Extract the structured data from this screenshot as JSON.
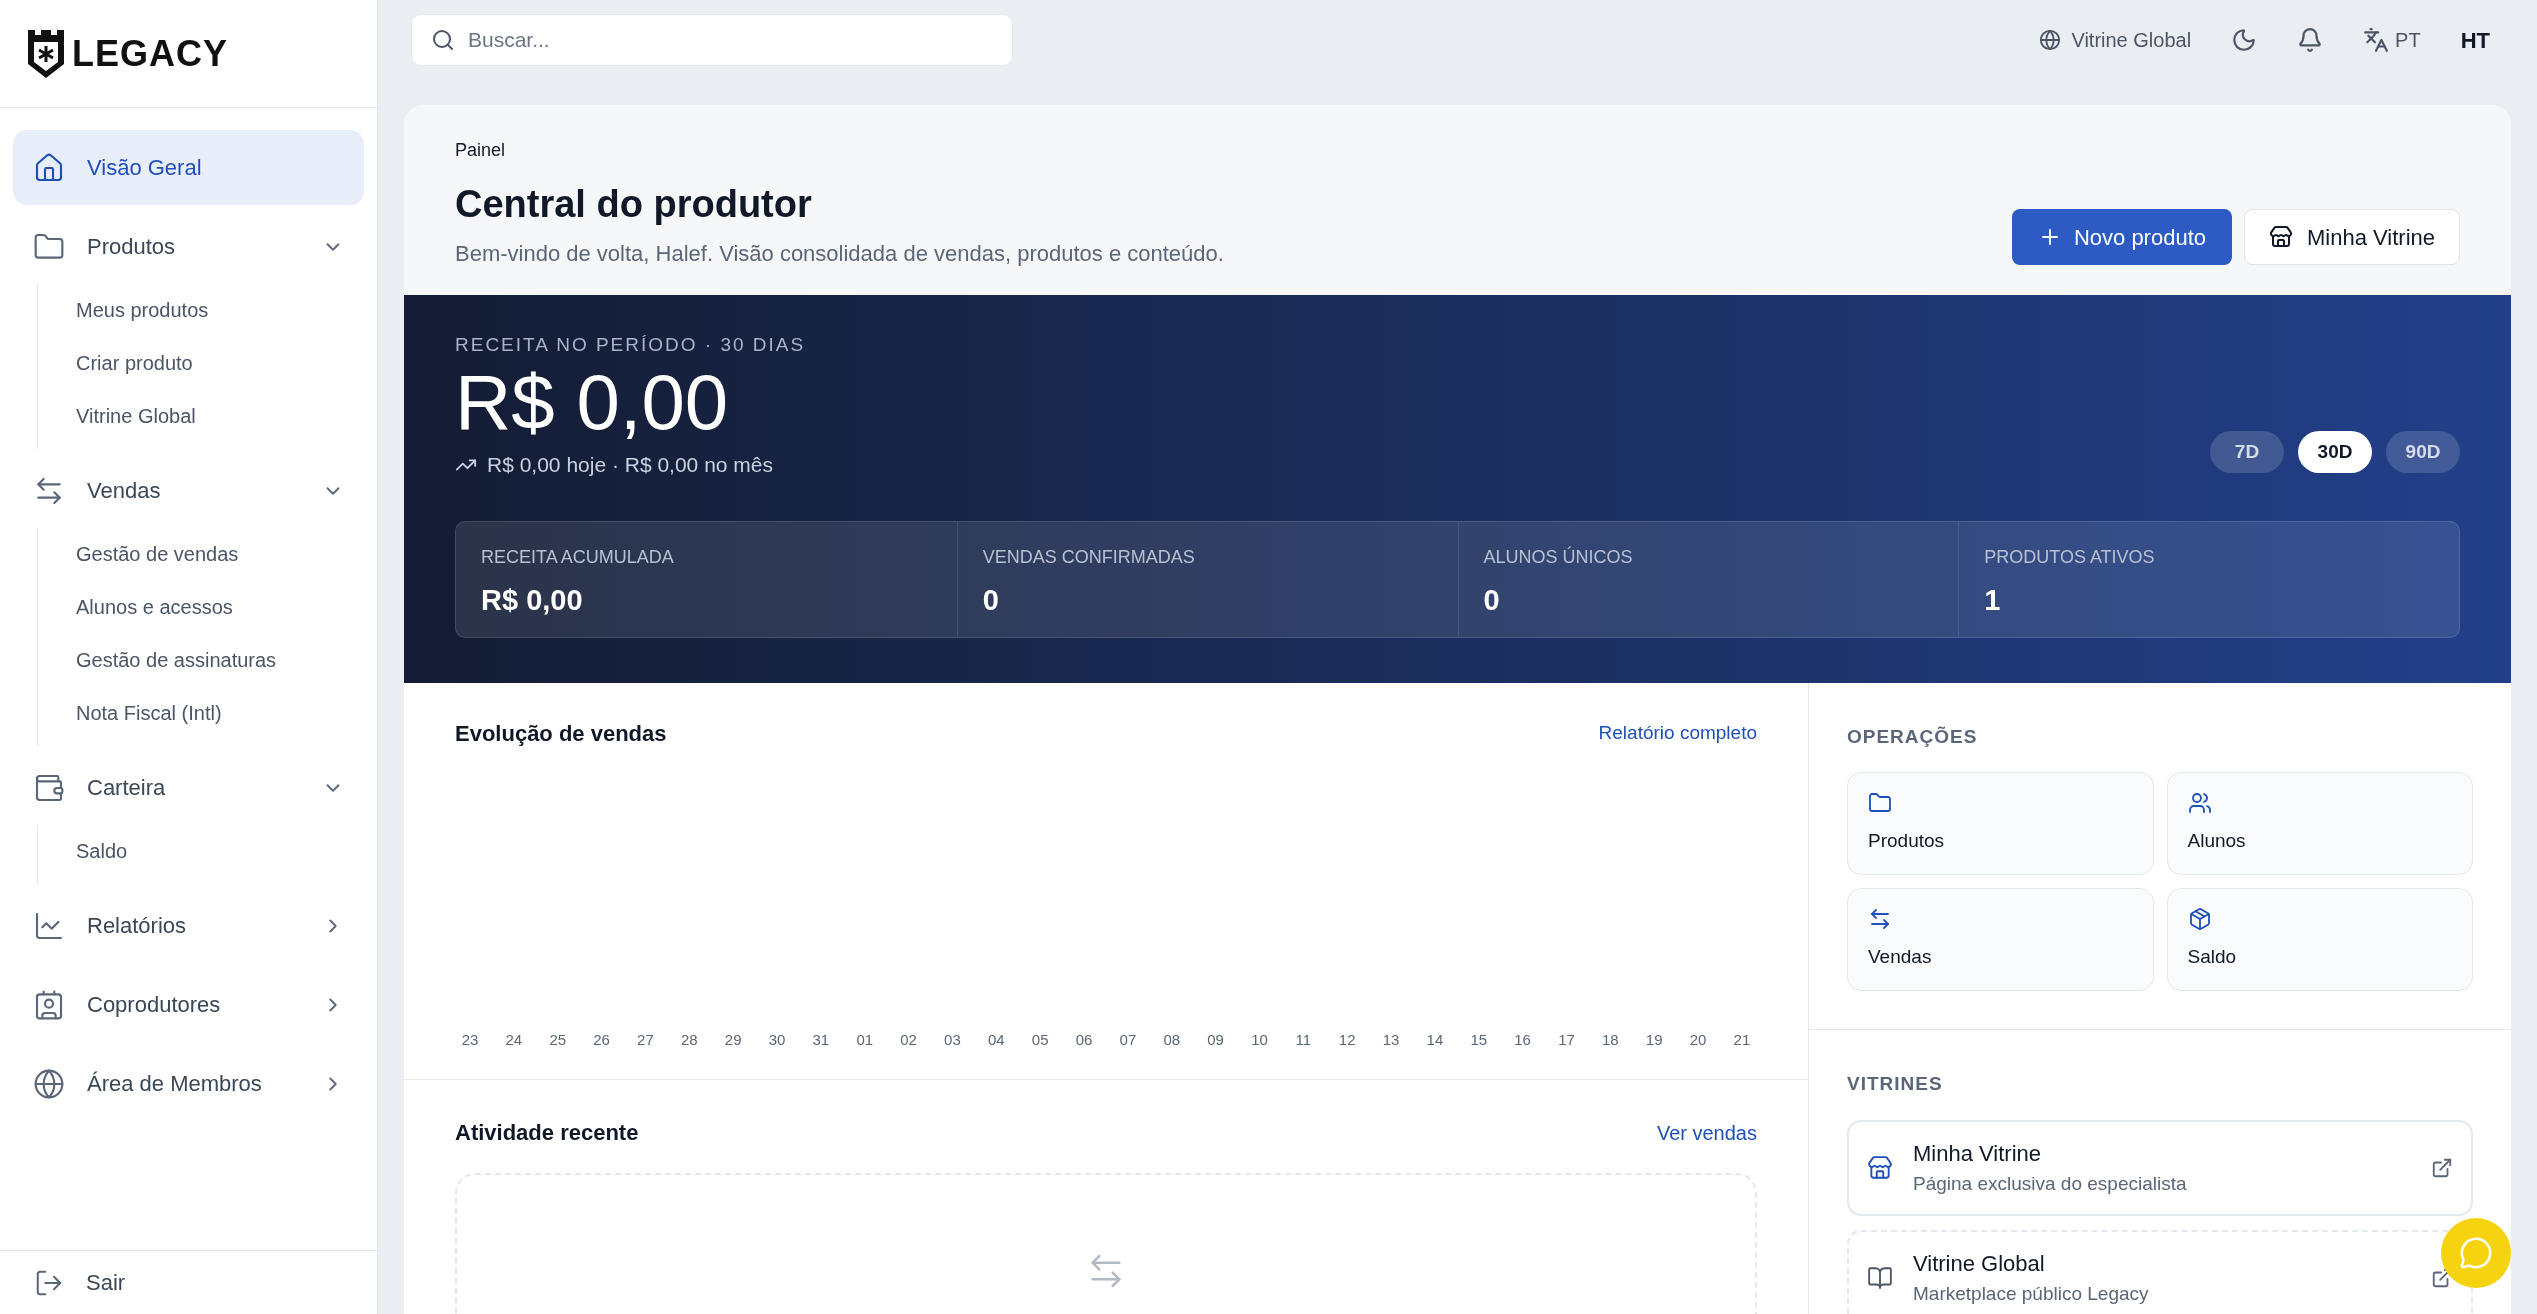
{
  "logo": {
    "text": "LEGACY"
  },
  "sidebar": {
    "items": [
      {
        "kind": "link",
        "label": "Visão Geral",
        "selected": true
      },
      {
        "kind": "group",
        "label": "Produtos",
        "selected": false,
        "expanded": true,
        "children": [
          {
            "label": "Meus produtos"
          },
          {
            "label": "Criar produto"
          },
          {
            "label": "Vitrine Global"
          }
        ]
      },
      {
        "kind": "group",
        "label": "Vendas",
        "selected": false,
        "expanded": true,
        "children": [
          {
            "label": "Gestão de vendas"
          },
          {
            "label": "Alunos e acessos"
          },
          {
            "label": "Gestão de assinaturas"
          },
          {
            "label": "Nota Fiscal (Intl)"
          }
        ]
      },
      {
        "kind": "group",
        "label": "Carteira",
        "selected": false,
        "expanded": true,
        "children": [
          {
            "label": "Saldo"
          }
        ]
      },
      {
        "kind": "group",
        "label": "Relatórios",
        "selected": false,
        "expanded": false
      },
      {
        "kind": "group",
        "label": "Coprodutores",
        "selected": false,
        "expanded": false
      },
      {
        "kind": "group",
        "label": "Área de Membros",
        "selected": false,
        "expanded": false
      }
    ],
    "logout": "Sair"
  },
  "topbar": {
    "search": {
      "placeholder": "Buscar..."
    },
    "storefront_link": "Vitrine Global",
    "language": "PT",
    "user_initials": "HT"
  },
  "header": {
    "breadcrumb": "Painel",
    "title": "Central do produtor",
    "subtitle": "Bem-vindo de volta, Halef. Visão consolidada de vendas, produtos e conteúdo.",
    "buttons": [
      {
        "kind": "primary",
        "label": "Novo produto"
      },
      {
        "kind": "secondary",
        "label": "Minha Vitrine"
      }
    ]
  },
  "revenue": {
    "label": "RECEITA NO PERÍODO · 30 DIAS",
    "amount": "R$ 0,00",
    "trend": "R$ 0,00 hoje · R$ 0,00 no mês",
    "periods": [
      {
        "label": "7D",
        "selected": false
      },
      {
        "label": "30D",
        "selected": true
      },
      {
        "label": "90D",
        "selected": false
      }
    ],
    "stats": [
      {
        "label": "RECEITA ACUMULADA",
        "value": "R$ 0,00"
      },
      {
        "label": "VENDAS CONFIRMADAS",
        "value": "0"
      },
      {
        "label": "ALUNOS ÚNICOS",
        "value": "0"
      },
      {
        "label": "PRODUTOS ATIVOS",
        "value": "1"
      }
    ]
  },
  "sales_chart": {
    "title": "Evolução de vendas",
    "link": "Relatório completo",
    "x_labels": [
      "23",
      "24",
      "25",
      "26",
      "27",
      "28",
      "29",
      "30",
      "31",
      "01",
      "02",
      "03",
      "04",
      "05",
      "06",
      "07",
      "08",
      "09",
      "10",
      "11",
      "12",
      "13",
      "14",
      "15",
      "16",
      "17",
      "18",
      "19",
      "20",
      "21"
    ]
  },
  "recent_activity": {
    "title": "Atividade recente",
    "link": "Ver vendas"
  },
  "operations": {
    "title": "OPERAÇÕES",
    "tiles": [
      {
        "label": "Produtos"
      },
      {
        "label": "Alunos"
      },
      {
        "label": "Vendas"
      },
      {
        "label": "Saldo"
      }
    ]
  },
  "storefronts": {
    "title": "VITRINES",
    "items": [
      {
        "kind": "solid",
        "title": "Minha Vitrine",
        "subtitle": "Página exclusiva do especialista"
      },
      {
        "kind": "dashed",
        "title": "Vitrine Global",
        "subtitle": "Marketplace público Legacy"
      }
    ]
  }
}
